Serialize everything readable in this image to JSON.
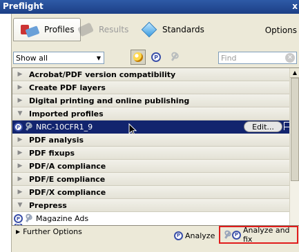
{
  "window": {
    "title": "Preflight",
    "close_glyph": "x"
  },
  "tabs": [
    {
      "label": "Profiles",
      "icon": "profiles-icon",
      "state": "active"
    },
    {
      "label": "Results",
      "icon": "results-icon",
      "state": "disabled"
    },
    {
      "label": "Standards",
      "icon": "standards-icon",
      "state": "normal"
    }
  ],
  "options_label": "Options",
  "filter": {
    "selected": "Show all",
    "find_placeholder": "Find"
  },
  "toolbar_icons": [
    "profile-pressed-icon",
    "check-profile-icon",
    "fixup-wrench-icon"
  ],
  "list": {
    "rows": [
      {
        "type": "category",
        "label": "Acrobat/PDF version compatibility",
        "expanded": false
      },
      {
        "type": "category",
        "label": "Create PDF layers",
        "expanded": false
      },
      {
        "type": "category",
        "label": "Digital printing and online publishing",
        "expanded": false
      },
      {
        "type": "category",
        "label": "Imported profiles",
        "expanded": true
      },
      {
        "type": "item",
        "label": "NRC-10CFR1_9",
        "selected": true
      },
      {
        "type": "category",
        "label": "PDF analysis",
        "expanded": false
      },
      {
        "type": "category",
        "label": "PDF fixups",
        "expanded": false
      },
      {
        "type": "category",
        "label": "PDF/A compliance",
        "expanded": false
      },
      {
        "type": "category",
        "label": "PDF/E compliance",
        "expanded": false
      },
      {
        "type": "category",
        "label": "PDF/X compliance",
        "expanded": false
      },
      {
        "type": "category",
        "label": "Prepress",
        "expanded": true
      },
      {
        "type": "item",
        "label": "Magazine Ads",
        "selected": false
      }
    ],
    "edit_label": "Edit..."
  },
  "bottom": {
    "further_options": "Further Options",
    "analyze_label": "Analyze",
    "analyze_fix_label": "Analyze and fix"
  },
  "colors": {
    "titlebar": "#1c3f86",
    "selection": "#12246e",
    "highlight_box": "#e01b1b"
  }
}
